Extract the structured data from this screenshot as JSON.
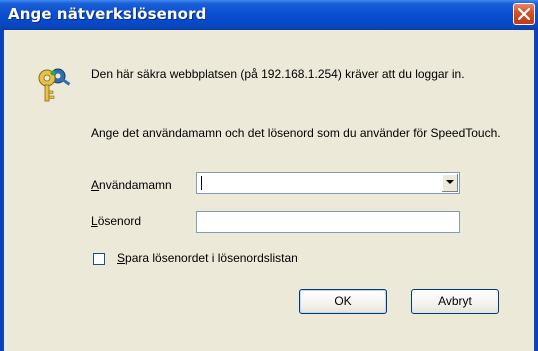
{
  "window": {
    "title": "Ange nätverkslösenord",
    "close_icon": "close-icon"
  },
  "message": {
    "line1": "Den här säkra webbplatsen (på 192.168.1.254) kräver att du loggar in.",
    "line2": "Ange det användamamn och det lösenord som du använder för SpeedTouch."
  },
  "form": {
    "username_label_accel": "A",
    "username_label_rest": "nvändamamn",
    "username_value": "",
    "password_label_accel": "L",
    "password_label_rest": "ösenord",
    "password_value": "",
    "save_label_accel": "S",
    "save_label_rest": "para lösenordet i lösenordslistan",
    "save_checked": false
  },
  "buttons": {
    "ok": "OK",
    "cancel": "Avbryt"
  },
  "colors": {
    "titlebar": "#0a4ed3",
    "close": "#d5512d",
    "dialog_bg": "#ece9d8"
  }
}
